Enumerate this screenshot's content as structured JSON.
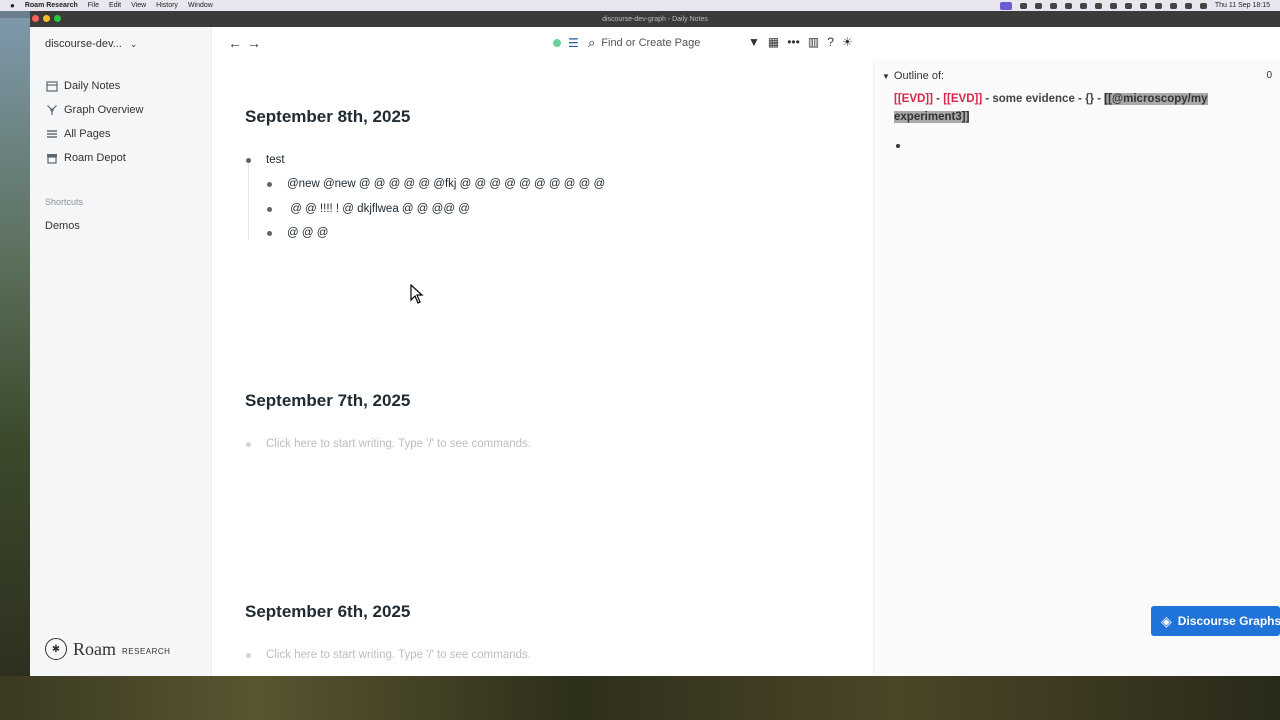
{
  "menubar": {
    "app": "Roam Research",
    "items": [
      "File",
      "Edit",
      "View",
      "History",
      "Window"
    ],
    "clock": "Thu 11 Sep  18:15"
  },
  "window": {
    "title": "discourse-dev-graph - Daily Notes"
  },
  "sidebar": {
    "graph_name": "discourse-dev...",
    "items": [
      {
        "label": "Daily Notes",
        "icon": "calendar-icon"
      },
      {
        "label": "Graph Overview",
        "icon": "graph-icon"
      },
      {
        "label": "All Pages",
        "icon": "list-icon"
      },
      {
        "label": "Roam Depot",
        "icon": "store-icon"
      }
    ],
    "shortcuts_label": "Shortcuts",
    "shortcuts": [
      "Demos"
    ],
    "logo_word": "Roam",
    "logo_sub": "RESEARCH"
  },
  "topbar": {
    "search_placeholder": "Find or Create Page"
  },
  "days": [
    {
      "title": "September 8th, 2025",
      "blocks": [
        {
          "text": "test",
          "level": 0
        },
        {
          "text": "@new @new @ @ @ @ @ @fkj @ @ @ @ @ @ @ @ @ @",
          "level": 1
        },
        {
          "text": " @ @ !!!! ! @ dkjflwea @ @ @@ @",
          "level": 1
        },
        {
          "text": "@ @ @",
          "level": 1
        }
      ]
    },
    {
      "title": "September 7th, 2025",
      "placeholder": "Click here to start writing. Type '/' to see commands."
    },
    {
      "title": "September 6th, 2025",
      "placeholder": "Click here to start writing. Type '/' to see commands."
    }
  ],
  "right_panel": {
    "outline_label": "Outline of:",
    "count": "0",
    "ref1": "[[EVD]]",
    "sep1": " - ",
    "ref2": "[[EVD]]",
    "mid": " - some evidence - {} - ",
    "highlight": "[[@microscopy/my experiment3]]"
  },
  "discourse_button": {
    "label": "Discourse Graphs"
  },
  "colors": {
    "accent_blue": "#1f73d9",
    "ref_red": "#d9254a",
    "sync_green": "#6ad29a"
  }
}
